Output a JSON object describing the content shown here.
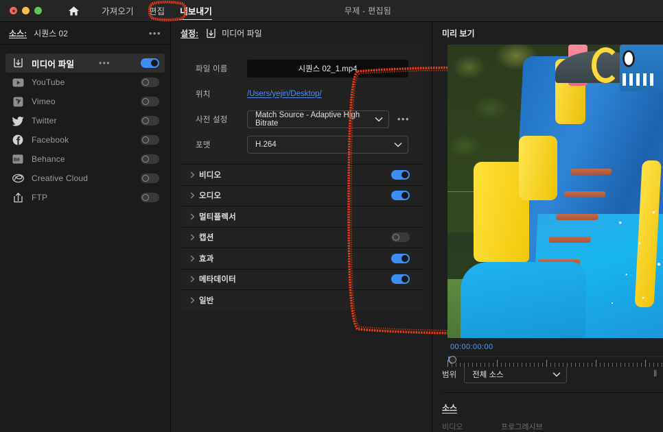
{
  "window": {
    "title": "무제 - 편집됨",
    "traffic_lights": [
      "close-red",
      "minimize-yellow",
      "maximize-green"
    ],
    "home_icon": "home-icon"
  },
  "nav": {
    "tabs": [
      {
        "label": "가져오기",
        "active": false
      },
      {
        "label": "편집",
        "active": false
      },
      {
        "label": "내보내기",
        "active": true
      }
    ]
  },
  "sidebar": {
    "label": "소스:",
    "sequence": "시퀀스 02",
    "overflow_icon": "more-options-icon",
    "items": [
      {
        "label": "미디어 파일",
        "icon": "media-file-icon",
        "toggle": "on",
        "selected": true,
        "has_overflow": true
      },
      {
        "label": "YouTube",
        "icon": "youtube-icon",
        "toggle": "off",
        "selected": false,
        "has_overflow": false
      },
      {
        "label": "Vimeo",
        "icon": "vimeo-icon",
        "toggle": "off",
        "selected": false,
        "has_overflow": false
      },
      {
        "label": "Twitter",
        "icon": "twitter-icon",
        "toggle": "off",
        "selected": false,
        "has_overflow": false
      },
      {
        "label": "Facebook",
        "icon": "facebook-icon",
        "toggle": "off",
        "selected": false,
        "has_overflow": false
      },
      {
        "label": "Behance",
        "icon": "behance-icon",
        "toggle": "off",
        "selected": false,
        "has_overflow": false
      },
      {
        "label": "Creative Cloud",
        "icon": "creative-cloud-icon",
        "toggle": "off",
        "selected": false,
        "has_overflow": false
      },
      {
        "label": "FTP",
        "icon": "ftp-upload-icon",
        "toggle": "off",
        "selected": false,
        "has_overflow": false
      }
    ]
  },
  "settings": {
    "label": "설정:",
    "target_icon": "media-file-icon",
    "target": "미디어 파일",
    "fields": {
      "filename_label": "파일 이름",
      "filename_value": "시퀀스 02_1.mp4",
      "location_label": "위치",
      "location_value": "/Users/yejin/Desktop/",
      "preset_label": "사전 설정",
      "preset_value": "Match Source - Adaptive High Bitrate",
      "preset_overflow_icon": "more-options-icon",
      "format_label": "포맷",
      "format_value": "H.264"
    },
    "sections": [
      {
        "label": "비디오",
        "toggle": "on"
      },
      {
        "label": "오디오",
        "toggle": "on"
      },
      {
        "label": "멀티플렉서",
        "toggle": "none"
      },
      {
        "label": "캡션",
        "toggle": "off"
      },
      {
        "label": "효과",
        "toggle": "on"
      },
      {
        "label": "메타데이터",
        "toggle": "on"
      },
      {
        "label": "일반",
        "toggle": "none"
      }
    ]
  },
  "preview": {
    "title": "미리 보기",
    "timecode": "00:00:00:00",
    "playhead_position": "00:00:00:00",
    "range_label": "범위",
    "range_value": "전체 소스",
    "source_title": "소스",
    "source_rows": [
      {
        "key": "비디오",
        "value": "프로그레시브"
      }
    ]
  },
  "annotations": {
    "color": "#f03c14",
    "shapes": [
      {
        "name": "export-tab-highlight",
        "target": "내보내기"
      },
      {
        "name": "settings-panel-highlight",
        "target": "설정 패널"
      }
    ]
  },
  "colors": {
    "accent_blue": "#3b8ef5",
    "link_blue": "#4f8ff0",
    "timecode_blue": "#4da3f0",
    "annotation_red": "#f03c14",
    "panel_bg": "#1e1e1e",
    "sidebar_bg": "#1b1b1b",
    "field_bg": "#222222"
  }
}
